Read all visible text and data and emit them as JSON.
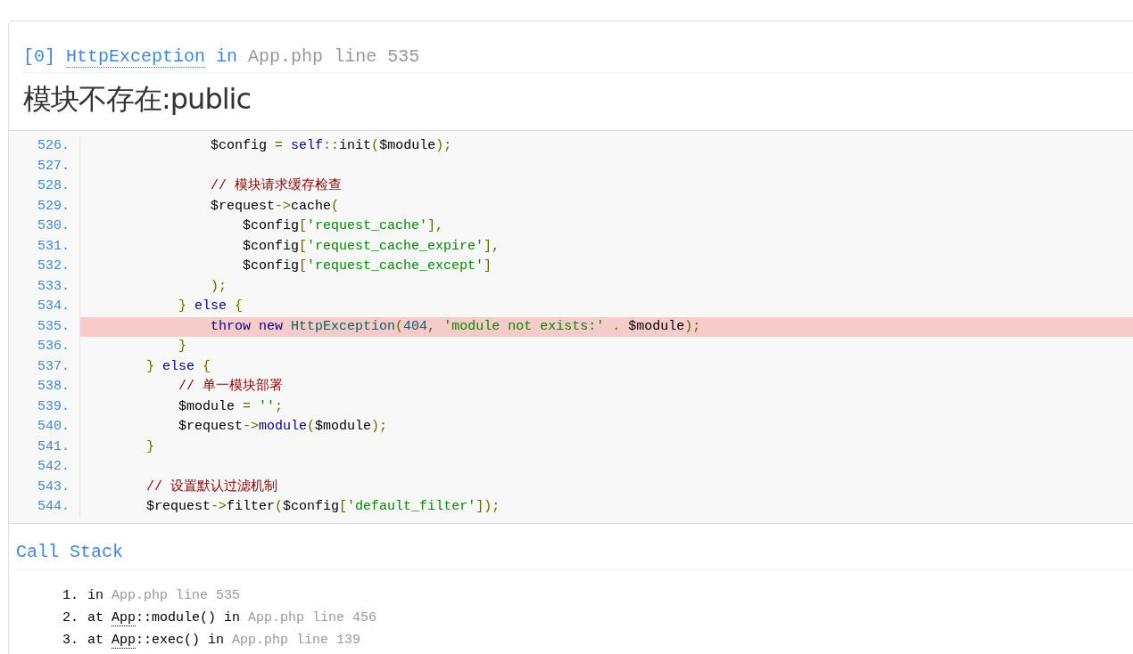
{
  "exception": {
    "index": "[0]",
    "class": "HttpException",
    "in": "in",
    "location": "App.php line 535"
  },
  "message": "模块不存在:public",
  "source": {
    "lines": [
      {
        "number": "526.",
        "selected": false,
        "tokens": [
          {
            "kind": "pln",
            "text": "                $config "
          },
          {
            "kind": "pun",
            "text": "= "
          },
          {
            "kind": "kwd",
            "text": "self"
          },
          {
            "kind": "pun",
            "text": "::"
          },
          {
            "kind": "pln",
            "text": "init"
          },
          {
            "kind": "pun",
            "text": "("
          },
          {
            "kind": "pln",
            "text": "$module"
          },
          {
            "kind": "pun",
            "text": ");"
          }
        ]
      },
      {
        "number": "527.",
        "selected": false
      },
      {
        "number": "528.",
        "selected": false,
        "tokens": [
          {
            "kind": "com",
            "text": "                // 模块请求缓存检查"
          }
        ]
      },
      {
        "number": "529.",
        "selected": false,
        "tokens": [
          {
            "kind": "pln",
            "text": "                $request"
          },
          {
            "kind": "pun",
            "text": "->"
          },
          {
            "kind": "pln",
            "text": "cache"
          },
          {
            "kind": "pun",
            "text": "("
          }
        ]
      },
      {
        "number": "530.",
        "selected": false,
        "tokens": [
          {
            "kind": "pln",
            "text": "                    $config"
          },
          {
            "kind": "pun",
            "text": "["
          },
          {
            "kind": "str",
            "text": "'request_cache'"
          },
          {
            "kind": "pun",
            "text": "],"
          }
        ]
      },
      {
        "number": "531.",
        "selected": false,
        "tokens": [
          {
            "kind": "pln",
            "text": "                    $config"
          },
          {
            "kind": "pun",
            "text": "["
          },
          {
            "kind": "str",
            "text": "'request_cache_expire'"
          },
          {
            "kind": "pun",
            "text": "],"
          }
        ]
      },
      {
        "number": "532.",
        "selected": false,
        "tokens": [
          {
            "kind": "pln",
            "text": "                    $config"
          },
          {
            "kind": "pun",
            "text": "["
          },
          {
            "kind": "str",
            "text": "'request_cache_except'"
          },
          {
            "kind": "pun",
            "text": "]"
          }
        ]
      },
      {
        "number": "533.",
        "selected": false,
        "tokens": [
          {
            "kind": "pun",
            "text": "                );"
          }
        ]
      },
      {
        "number": "534.",
        "selected": false,
        "tokens": [
          {
            "kind": "pun",
            "text": "            } "
          },
          {
            "kind": "kwd",
            "text": "else"
          },
          {
            "kind": "pun",
            "text": " {"
          }
        ]
      },
      {
        "number": "535.",
        "selected": true,
        "tokens": [
          {
            "kind": "kwd",
            "text": "                throw new "
          },
          {
            "kind": "typ",
            "text": "HttpException"
          },
          {
            "kind": "pun",
            "text": "("
          },
          {
            "kind": "lit",
            "text": "404"
          },
          {
            "kind": "pun",
            "text": ", "
          },
          {
            "kind": "str",
            "text": "'module not exists:'"
          },
          {
            "kind": "pun",
            "text": " . "
          },
          {
            "kind": "pln",
            "text": "$module"
          },
          {
            "kind": "pun",
            "text": ");"
          }
        ]
      },
      {
        "number": "536.",
        "selected": false,
        "tokens": [
          {
            "kind": "pun",
            "text": "            }"
          }
        ]
      },
      {
        "number": "537.",
        "selected": false,
        "tokens": [
          {
            "kind": "pun",
            "text": "        } "
          },
          {
            "kind": "kwd",
            "text": "else"
          },
          {
            "kind": "pun",
            "text": " {"
          }
        ]
      },
      {
        "number": "538.",
        "selected": false,
        "tokens": [
          {
            "kind": "com",
            "text": "            // 单一模块部署"
          }
        ]
      },
      {
        "number": "539.",
        "selected": false,
        "tokens": [
          {
            "kind": "pln",
            "text": "            $module "
          },
          {
            "kind": "pun",
            "text": "= "
          },
          {
            "kind": "str",
            "text": "''"
          },
          {
            "kind": "pun",
            "text": ";"
          }
        ]
      },
      {
        "number": "540.",
        "selected": false,
        "tokens": [
          {
            "kind": "pln",
            "text": "            $request"
          },
          {
            "kind": "pun",
            "text": "->"
          },
          {
            "kind": "kwd",
            "text": "module"
          },
          {
            "kind": "pun",
            "text": "("
          },
          {
            "kind": "pln",
            "text": "$module"
          },
          {
            "kind": "pun",
            "text": ");"
          }
        ]
      },
      {
        "number": "541.",
        "selected": false,
        "tokens": [
          {
            "kind": "pun",
            "text": "        }"
          }
        ]
      },
      {
        "number": "542.",
        "selected": false
      },
      {
        "number": "543.",
        "selected": false,
        "tokens": [
          {
            "kind": "com",
            "text": "        // 设置默认过滤机制"
          }
        ]
      },
      {
        "number": "544.",
        "selected": false,
        "tokens": [
          {
            "kind": "pln",
            "text": "        $request"
          },
          {
            "kind": "pun",
            "text": "->"
          },
          {
            "kind": "pln",
            "text": "filter"
          },
          {
            "kind": "pun",
            "text": "("
          },
          {
            "kind": "pln",
            "text": "$config"
          },
          {
            "kind": "pun",
            "text": "["
          },
          {
            "kind": "str",
            "text": "'default_filter'"
          },
          {
            "kind": "pun",
            "text": "]);"
          }
        ]
      }
    ]
  },
  "call_stack": {
    "title": "Call Stack",
    "items": [
      {
        "number": "1.",
        "parts": [
          {
            "kind": "plain",
            "text": "in "
          },
          {
            "kind": "file",
            "text": "App.php line 535"
          }
        ]
      },
      {
        "number": "2.",
        "parts": [
          {
            "kind": "plain",
            "text": "at "
          },
          {
            "kind": "abbr",
            "text": "App"
          },
          {
            "kind": "plain",
            "text": "::module() in "
          },
          {
            "kind": "file",
            "text": "App.php line 456"
          }
        ]
      },
      {
        "number": "3.",
        "parts": [
          {
            "kind": "plain",
            "text": "at "
          },
          {
            "kind": "abbr",
            "text": "App"
          },
          {
            "kind": "plain",
            "text": "::exec() in "
          },
          {
            "kind": "file",
            "text": "App.php line 139"
          }
        ]
      }
    ]
  }
}
